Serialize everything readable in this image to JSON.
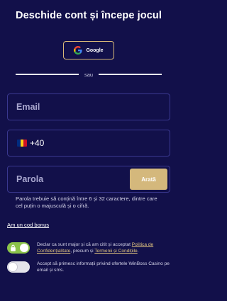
{
  "header": {
    "title": "Deschide cont și începe jocul"
  },
  "social": {
    "google_label": "Google"
  },
  "divider": {
    "text": "sau"
  },
  "form": {
    "email_placeholder": "Email",
    "phone_code": "+40",
    "password_placeholder": "Parola",
    "show_password_label": "Arată",
    "password_hint": "Parola trebuie să conțină între 6 și 32 caractere, dintre care cel puțin o majusculă și o cifră.",
    "bonus_code_link": "Am un cod bonus"
  },
  "consents": {
    "terms": {
      "checked": true,
      "text_1": "Declar ca sunt major și că am citit și acceptat ",
      "link_1": "Politica de Confidențialitate",
      "text_2": ", precum și ",
      "link_2": "Termenii și Condițiile",
      "text_3": "."
    },
    "offers": {
      "checked": false,
      "text": "Accept să primesc informații privind ofertele WinBoss Casino pe email și sms."
    }
  },
  "colors": {
    "background": "#12104a",
    "accent_gold": "#d4b87c",
    "toggle_on": "#8bc34a",
    "field_border": "#3a3890",
    "flag_blue": "#002b7f",
    "flag_yellow": "#fcd116",
    "flag_red": "#ce1126"
  },
  "icons": {
    "google": "google-icon",
    "flag": "romania-flag-icon",
    "lock": "lock-icon"
  }
}
